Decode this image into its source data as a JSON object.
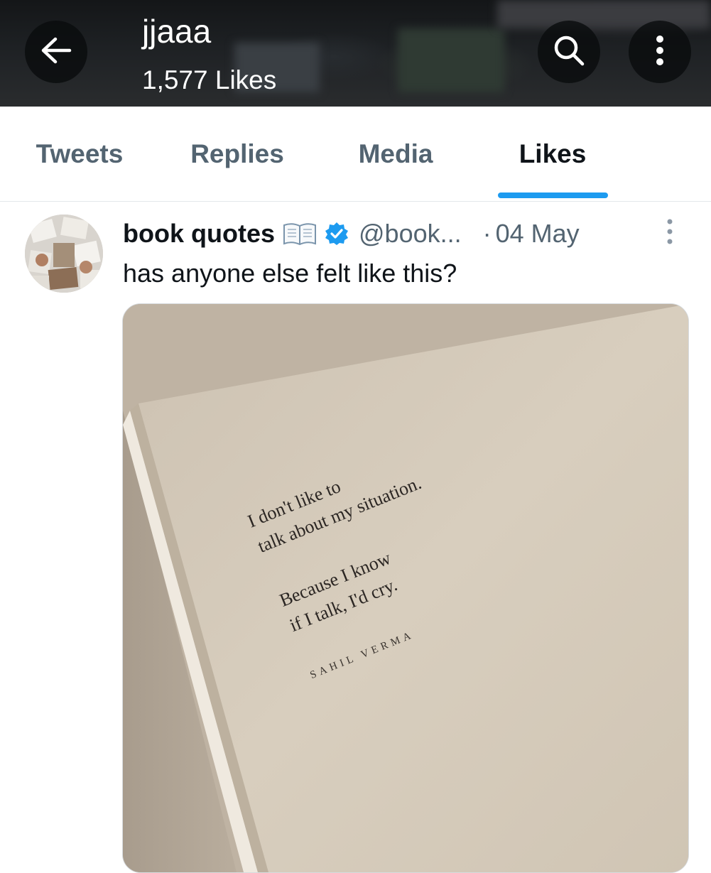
{
  "header": {
    "name": "jjaaa",
    "count": "1,577 Likes",
    "back_icon": "arrow-left-icon",
    "search_icon": "search-icon",
    "more_icon": "more-vertical-icon"
  },
  "tabs": [
    {
      "label": "Tweets",
      "active": false
    },
    {
      "label": "Replies",
      "active": false
    },
    {
      "label": "Media",
      "active": false
    },
    {
      "label": "Likes",
      "active": true
    }
  ],
  "tweet": {
    "display_name": "book quotes",
    "handle": "@book...",
    "separator": "·",
    "date": "04 May",
    "text": "has anyone else felt like this?",
    "badges": [
      "open-book-emoji-icon",
      "verified-badge-icon"
    ],
    "media": {
      "lines": [
        "I don't like to",
        "talk about my situation.",
        "Because I know",
        "if I talk, I'd cry."
      ],
      "author": "SAHIL VERMA"
    }
  },
  "colors": {
    "accent": "#1d9bf0",
    "text_primary": "#0f1419",
    "text_secondary": "#536471"
  }
}
